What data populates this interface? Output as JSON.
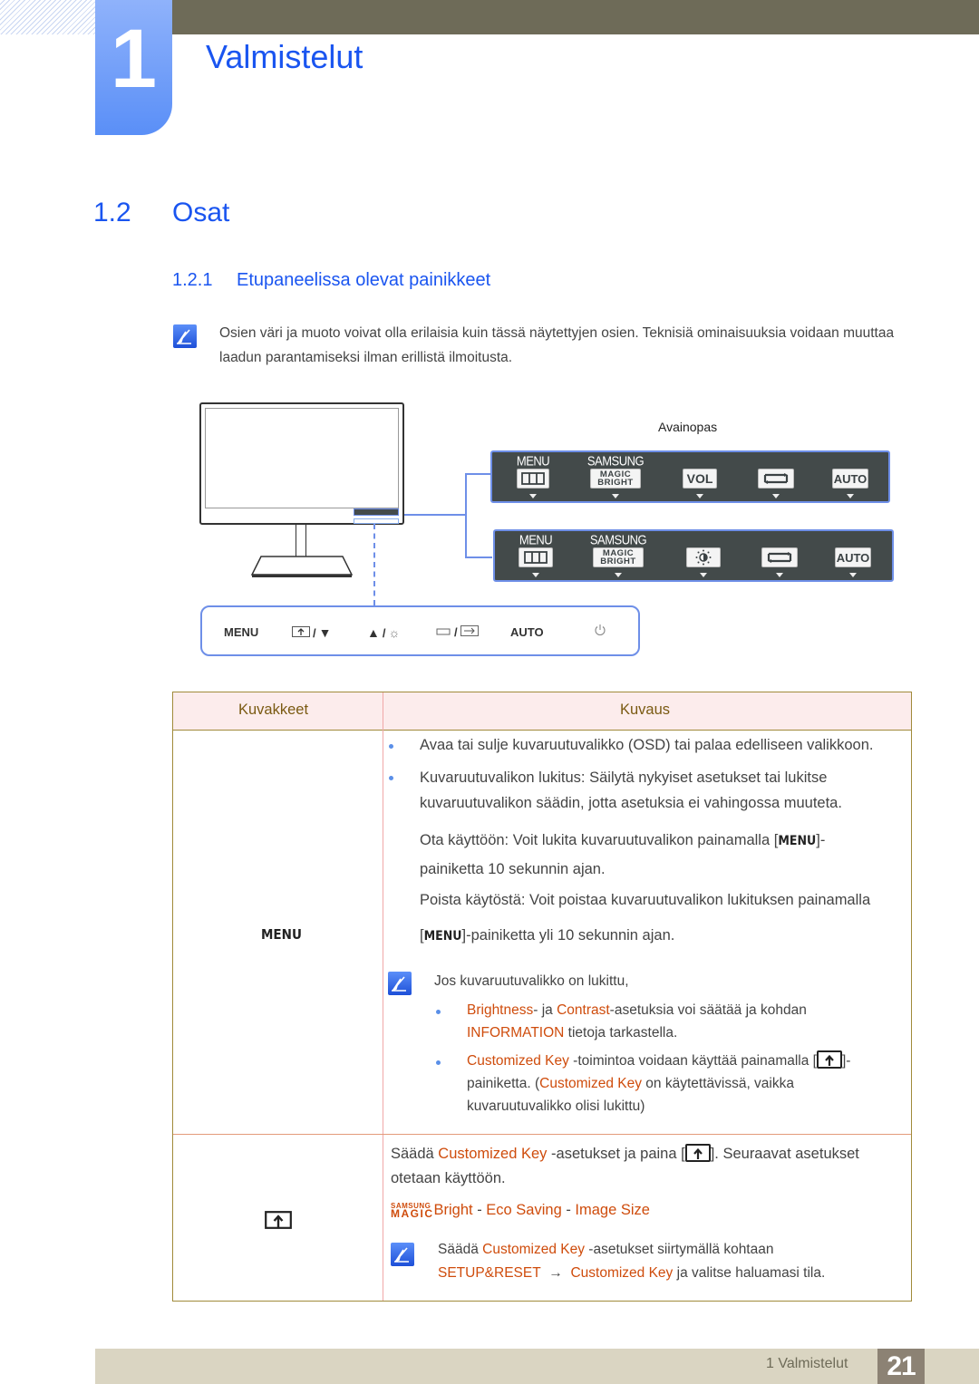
{
  "header": {
    "chapter_number": "1",
    "chapter_title": "Valmistelut"
  },
  "section": {
    "number": "1.2",
    "title": "Osat"
  },
  "subsection": {
    "number": "1.2.1",
    "title": "Etupaneelissa olevat painikkeet"
  },
  "intro_note": "Osien väri ja muoto voivat olla erilaisia kuin tässä näytettyjen osien. Teknisiä ominaisuuksia voidaan muuttaa laadun parantamiseksi ilman erillistä ilmoitusta.",
  "diagram": {
    "key_guide_label": "Avainopas",
    "panel_a": {
      "keys": [
        {
          "caption": "MENU",
          "face": "menu-icon"
        },
        {
          "caption": "SAMSUNG",
          "face_line1": "MAGIC",
          "face_line2": "BRIGHT"
        },
        {
          "caption": "",
          "face": "VOL"
        },
        {
          "caption": "",
          "face": "source-swap-icon"
        },
        {
          "caption": "",
          "face": "AUTO"
        }
      ]
    },
    "panel_b": {
      "keys": [
        {
          "caption": "MENU",
          "face": "menu-icon"
        },
        {
          "caption": "SAMSUNG",
          "face_line1": "MAGIC",
          "face_line2": "BRIGHT"
        },
        {
          "caption": "",
          "face": "brightness-icon"
        },
        {
          "caption": "",
          "face": "source-swap-icon"
        },
        {
          "caption": "",
          "face": "AUTO"
        }
      ]
    },
    "front_strip": {
      "menu": "MENU",
      "sep": "/",
      "auto": "AUTO"
    }
  },
  "table": {
    "headers": [
      "Kuvakkeet",
      "Kuvaus"
    ],
    "row1": {
      "icon_label": "MENU",
      "bullets": [
        "Avaa tai sulje kuvaruutuvalikko (OSD) tai palaa edelliseen valikkoon.",
        "Kuvaruutuvalikon lukitus: Säilytä nykyiset asetukset tai lukitse kuvaruutuvalikon säädin, jotta asetuksia ei vahingossa muuteta."
      ],
      "enable_pre": "Ota käyttöön: Voit lukita kuvaruutuvalikon painamalla [",
      "enable_key": "MENU",
      "enable_post1": "]-",
      "enable_post2": "painiketta 10 sekunnin ajan.",
      "disable_line1": "Poista käytöstä: Voit poistaa kuvaruutuvalikon lukituksen painamalla",
      "disable_pre": "[",
      "disable_key": "MENU",
      "disable_post": "]-painiketta yli 10 sekunnin ajan.",
      "note_intro": "Jos kuvaruutuvalikko on lukittu,",
      "note_b1_brightness": "Brightness",
      "note_b1_mid": "- ja ",
      "note_b1_contrast": "Contrast",
      "note_b1_rest": "-asetuksia voi säätää ja kohdan",
      "note_b1_information": "INFORMATION",
      "note_b1_end": " tietoja tarkastella.",
      "note_b2_ck": "Customized Key",
      "note_b2_rest": " -toimintoa voidaan käyttää painamalla [",
      "note_b2_after": "]-",
      "note_b2_line2_pre": "painiketta. (",
      "note_b2_line2_ck": "Customized Key",
      "note_b2_line2_post": " on käytettävissä, vaikka",
      "note_b2_line3": "kuvaruutuvalikko olisi lukittu)"
    },
    "row2": {
      "line1_pre": "Säädä ",
      "line1_ck": "Customized Key",
      "line1_mid": " -asetukset ja paina [",
      "line1_post": "]. Seuraavat asetukset",
      "line2": "otetaan käyttöön.",
      "magic_small": "SAMSUNG",
      "magic_big": "MAGIC",
      "options": [
        "Bright",
        "Eco Saving",
        "Image Size"
      ],
      "option_sep": " - ",
      "note_pre": "Säädä ",
      "note_ck": "Customized Key",
      "note_post": " -asetukset siirtymällä kohtaan",
      "note_setup": "SETUP&RESET",
      "note_arrow": "→",
      "note_ck2": "Customized Key",
      "note_end": " ja valitse haluamasi tila."
    }
  },
  "footer": {
    "label": "1 Valmistelut",
    "page": "21"
  },
  "colors": {
    "heading_blue": "#1a55f0",
    "highlight_orange": "#cf4c0c",
    "header_bar": "#6e6b58",
    "footer_bar": "#dad5c2",
    "page_box": "#8c8274"
  }
}
